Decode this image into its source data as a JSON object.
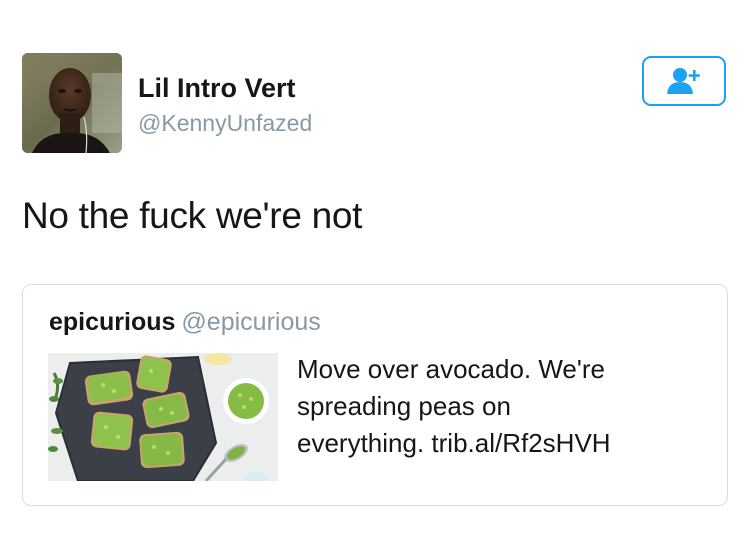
{
  "author": {
    "display_name": "Lil Intro Vert",
    "username": "@KennyUnfazed"
  },
  "follow_button": {
    "icon": "add-user-icon",
    "color": "#1da1f2"
  },
  "tweet": {
    "text": "No the fuck we're not"
  },
  "quoted_tweet": {
    "display_name": "epicurious",
    "username": "@epicurious",
    "text_lines": [
      "Move over avocado. We're",
      "spreading peas on",
      "everything. trib.al/Rf2sHVH"
    ]
  },
  "colors": {
    "accent": "#1da1f2",
    "secondary_text": "#8899a6",
    "border": "#d8dee3"
  }
}
